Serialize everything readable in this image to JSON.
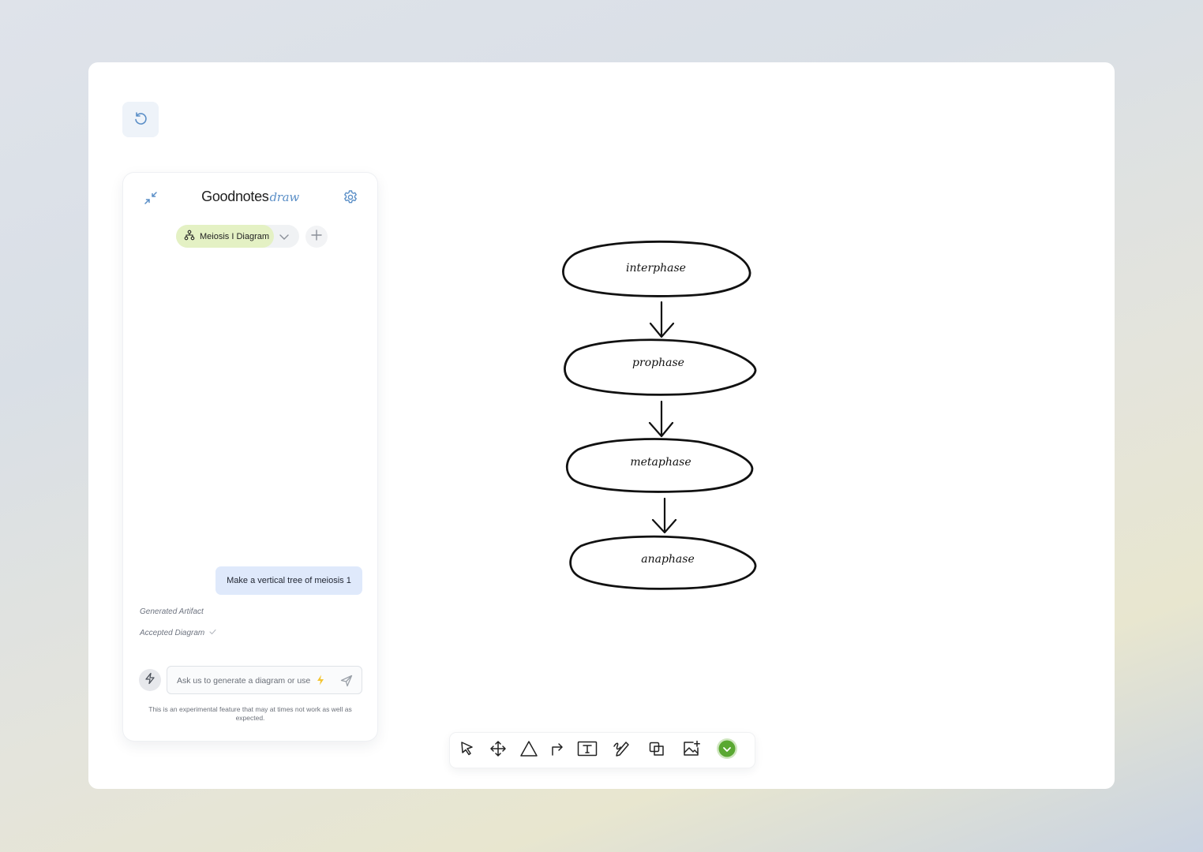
{
  "app": {
    "brand_main": "Goodnotes",
    "brand_accent": "draw",
    "accent_color": "#5b8fc7",
    "chip_color": "#e4f1c4",
    "user_bubble_color": "#dfe9fb"
  },
  "panel": {
    "diagram_name": "Meiosis I Diagram",
    "messages": [
      {
        "role": "user",
        "text": "Make a vertical tree of meiosis 1"
      }
    ],
    "status": {
      "generated": "Generated Artifact",
      "accepted": "Accepted Diagram"
    },
    "input": {
      "placeholder": "Ask us to generate a diagram or use"
    },
    "disclaimer": "This is an experimental feature that may at times not work as well as expected."
  },
  "diagram": {
    "nodes": [
      {
        "label": "interphase"
      },
      {
        "label": "prophase"
      },
      {
        "label": "metaphase"
      },
      {
        "label": "anaphase"
      }
    ]
  },
  "toolbar": {
    "tools": [
      "select-tool",
      "move-tool",
      "shape-tool",
      "connector-tool",
      "text-tool",
      "pen-tool",
      "copy-tool",
      "image-tool",
      "confirm-tool"
    ],
    "confirm_color": "#5aa832"
  }
}
